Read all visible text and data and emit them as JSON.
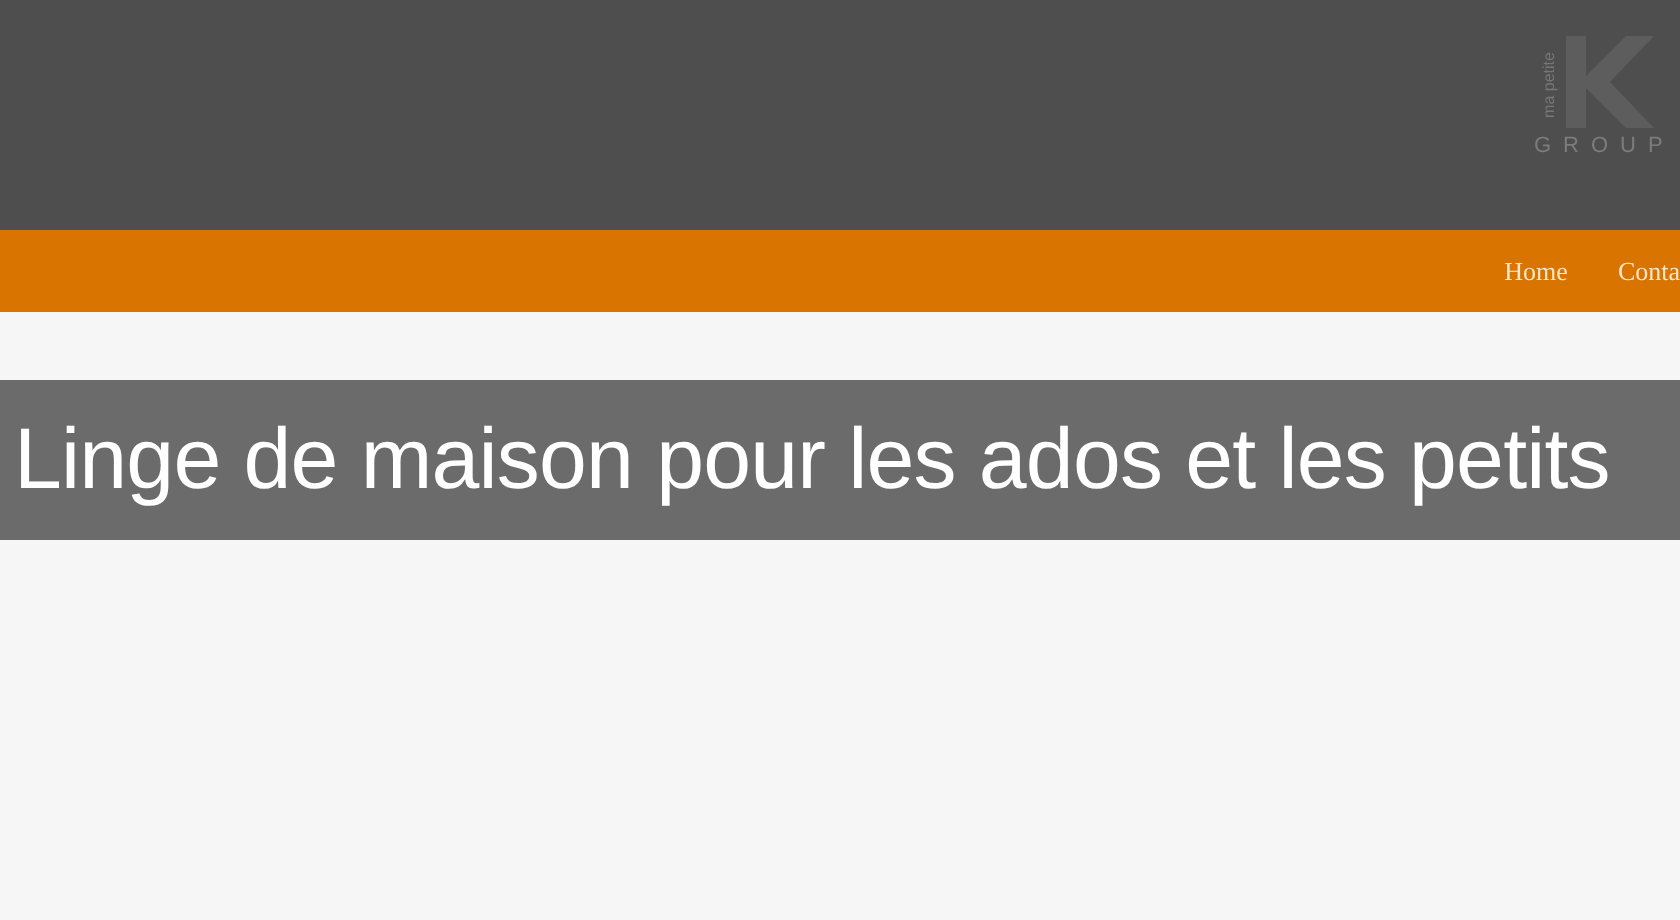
{
  "logo": {
    "tagline": "ma petite",
    "group": "GROUP"
  },
  "nav": [
    {
      "label": "Home"
    },
    {
      "label": "Conta"
    }
  ],
  "banner": {
    "title": "Linge de maison pour les ados et les petits"
  }
}
